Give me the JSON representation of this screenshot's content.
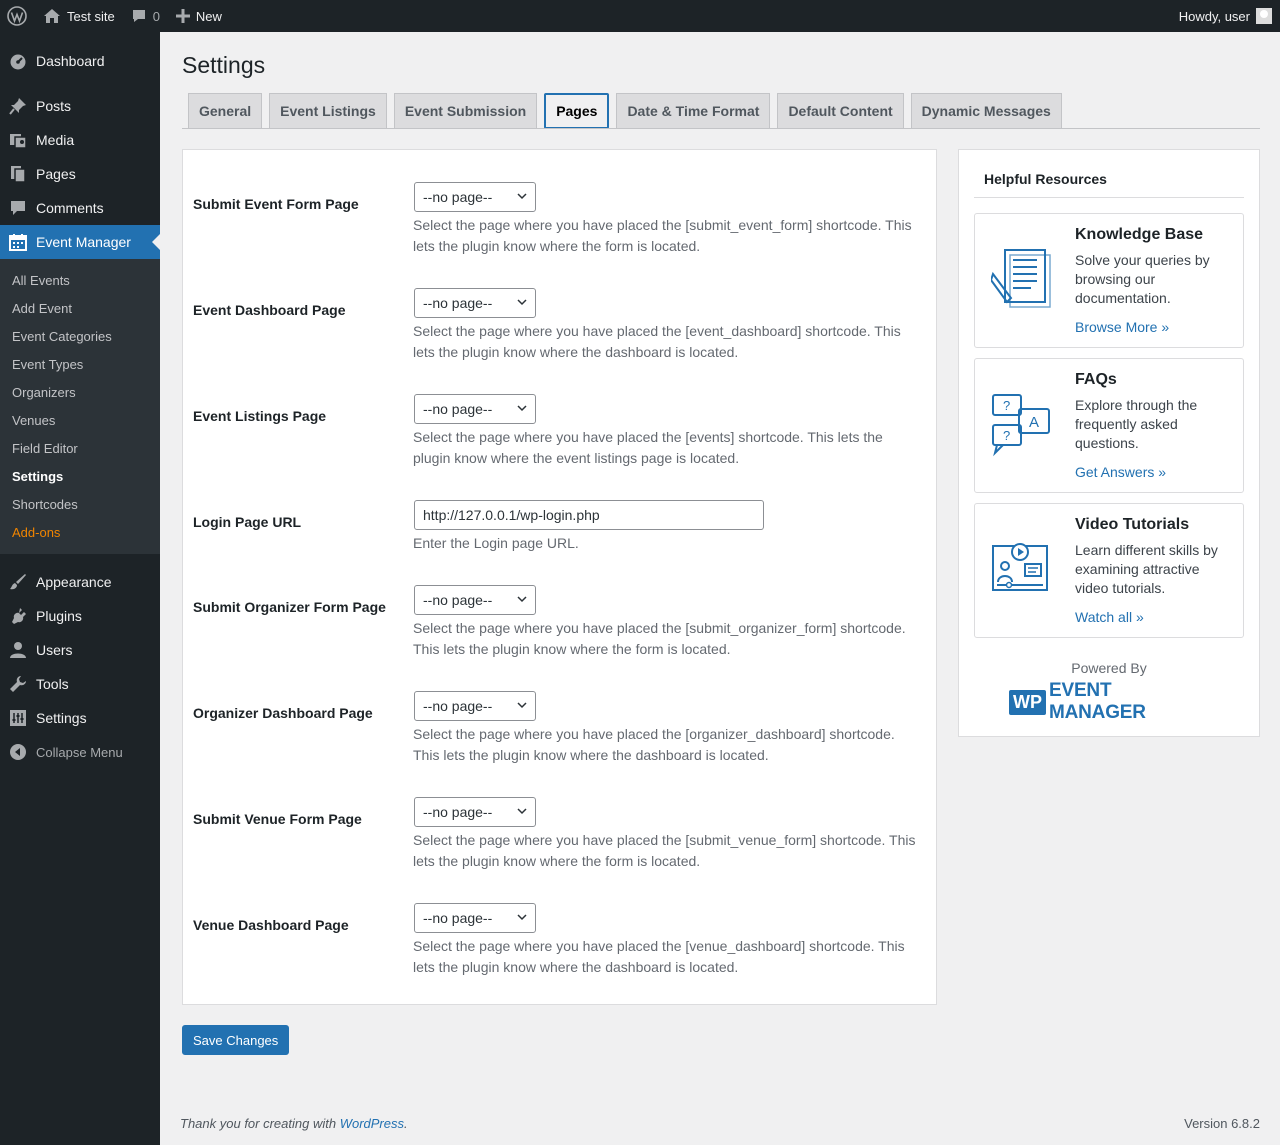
{
  "admin_bar": {
    "site_name": "Test site",
    "comments_count": "0",
    "new_label": "New",
    "greeting": "Howdy, user"
  },
  "sidebar": {
    "items": [
      {
        "label": "Dashboard",
        "icon": "dashboard-icon"
      },
      {
        "label": "Posts",
        "icon": "pin-icon"
      },
      {
        "label": "Media",
        "icon": "media-icon"
      },
      {
        "label": "Pages",
        "icon": "pages-icon"
      },
      {
        "label": "Comments",
        "icon": "comment-icon"
      },
      {
        "label": "Event Manager",
        "icon": "calendar-icon"
      }
    ],
    "submenu": [
      "All Events",
      "Add Event",
      "Event Categories",
      "Event Types",
      "Organizers",
      "Venues",
      "Field Editor",
      "Settings",
      "Shortcodes",
      "Add-ons"
    ],
    "items_after": [
      {
        "label": "Appearance",
        "icon": "brush-icon"
      },
      {
        "label": "Plugins",
        "icon": "plug-icon"
      },
      {
        "label": "Users",
        "icon": "user-icon"
      },
      {
        "label": "Tools",
        "icon": "wrench-icon"
      },
      {
        "label": "Settings",
        "icon": "settings-icon"
      }
    ],
    "collapse_label": "Collapse Menu"
  },
  "page": {
    "title": "Settings",
    "tabs": [
      "General",
      "Event Listings",
      "Event Submission",
      "Pages",
      "Date & Time Format",
      "Default Content",
      "Dynamic Messages"
    ],
    "active_tab": "Pages"
  },
  "settings": [
    {
      "label": "Submit Event Form Page",
      "type": "select",
      "value": "--no page--",
      "desc": "Select the page where you have placed the [submit_event_form] shortcode. This lets the plugin know where the form is located."
    },
    {
      "label": "Event Dashboard Page",
      "type": "select",
      "value": "--no page--",
      "desc": "Select the page where you have placed the [event_dashboard] shortcode. This lets the plugin know where the dashboard is located."
    },
    {
      "label": "Event Listings Page",
      "type": "select",
      "value": "--no page--",
      "desc": "Select the page where you have placed the [events] shortcode. This lets the plugin know where the event listings page is located."
    },
    {
      "label": "Login Page URL",
      "type": "input",
      "value": "http://127.0.0.1/wp-login.php",
      "desc": "Enter the Login page URL."
    },
    {
      "label": "Submit Organizer Form Page",
      "type": "select",
      "value": "--no page--",
      "desc": "Select the page where you have placed the [submit_organizer_form] shortcode. This lets the plugin know where the form is located."
    },
    {
      "label": "Organizer Dashboard Page",
      "type": "select",
      "value": "--no page--",
      "desc": "Select the page where you have placed the [organizer_dashboard] shortcode. This lets the plugin know where the dashboard is located."
    },
    {
      "label": "Submit Venue Form Page",
      "type": "select",
      "value": "--no page--",
      "desc": "Select the page where you have placed the [submit_venue_form] shortcode. This lets the plugin know where the form is located."
    },
    {
      "label": "Venue Dashboard Page",
      "type": "select",
      "value": "--no page--",
      "desc": "Select the page where you have placed the [venue_dashboard] shortcode. This lets the plugin know where the dashboard is located."
    }
  ],
  "save_label": "Save Changes",
  "resources": {
    "title": "Helpful Resources",
    "cards": [
      {
        "title": "Knowledge Base",
        "text": "Solve your queries by browsing our documentation.",
        "link": "Browse More »",
        "icon": "document-icon"
      },
      {
        "title": "FAQs",
        "text": "Explore through the frequently asked questions.",
        "link": "Get Answers »",
        "icon": "faq-icon"
      },
      {
        "title": "Video Tutorials",
        "text": "Learn different skills by examining attractive video tutorials.",
        "link": "Watch all »",
        "icon": "video-icon"
      }
    ],
    "powered_by": "Powered By",
    "logo_wp": "WP",
    "logo_text": "EVENT MANAGER"
  },
  "footer": {
    "thanks_prefix": "Thank you for creating with ",
    "thanks_link": "WordPress",
    "thanks_suffix": ".",
    "version": "Version 6.8.2"
  },
  "colors": {
    "accent": "#2271b1",
    "sidebar_bg": "#1d2327",
    "addons": "#f18500"
  }
}
